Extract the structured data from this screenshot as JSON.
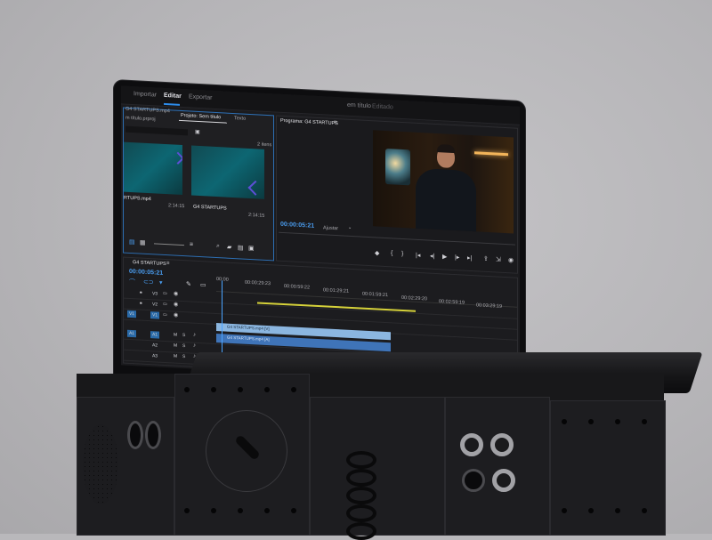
{
  "app": {
    "tabs": [
      {
        "label": "Importar"
      },
      {
        "label": "Editar"
      },
      {
        "label": "Exportar"
      }
    ],
    "window_title": "em título",
    "window_subtitle": "Editado"
  },
  "project_panel": {
    "file_top": "G4 STARTUPS.mp4",
    "project_file": "m título.prproj",
    "tabs": [
      {
        "label": "Projeto: Sem título"
      },
      {
        "label": "Texto"
      }
    ],
    "items_count": "2 itens",
    "items": [
      {
        "name": "RTUPS.mp4",
        "duration": ""
      },
      {
        "name": "G4 STARTUPS",
        "duration": "2:14:15"
      }
    ],
    "left_duration": "2:14:15"
  },
  "program_monitor": {
    "title": "Programa: G4 STARTUPS",
    "timecode": "00:00:05:21",
    "fit_label": "Ajustar"
  },
  "timeline": {
    "sequence_name": "G4 STARTUPS",
    "timecode": "00:00:05:21",
    "ruler": [
      "00:00",
      "00:00:29:23",
      "00:00:59:22",
      "00:01:29:21",
      "00:01:59:21",
      "00:02:29:20",
      "00:02:59:19",
      "00:03:29:19"
    ],
    "video_tracks": [
      "V3",
      "V2",
      "V1"
    ],
    "audio_tracks": [
      "A1",
      "A2",
      "A3"
    ],
    "video_clip": "G4 STARTUPS.mp4 [V]",
    "audio_clip": "G4 STARTUPS.mp4 [A]"
  },
  "colors": {
    "accent": "#2d8ceb",
    "timecode": "#4a9df0",
    "work_area": "#d6d23a"
  }
}
